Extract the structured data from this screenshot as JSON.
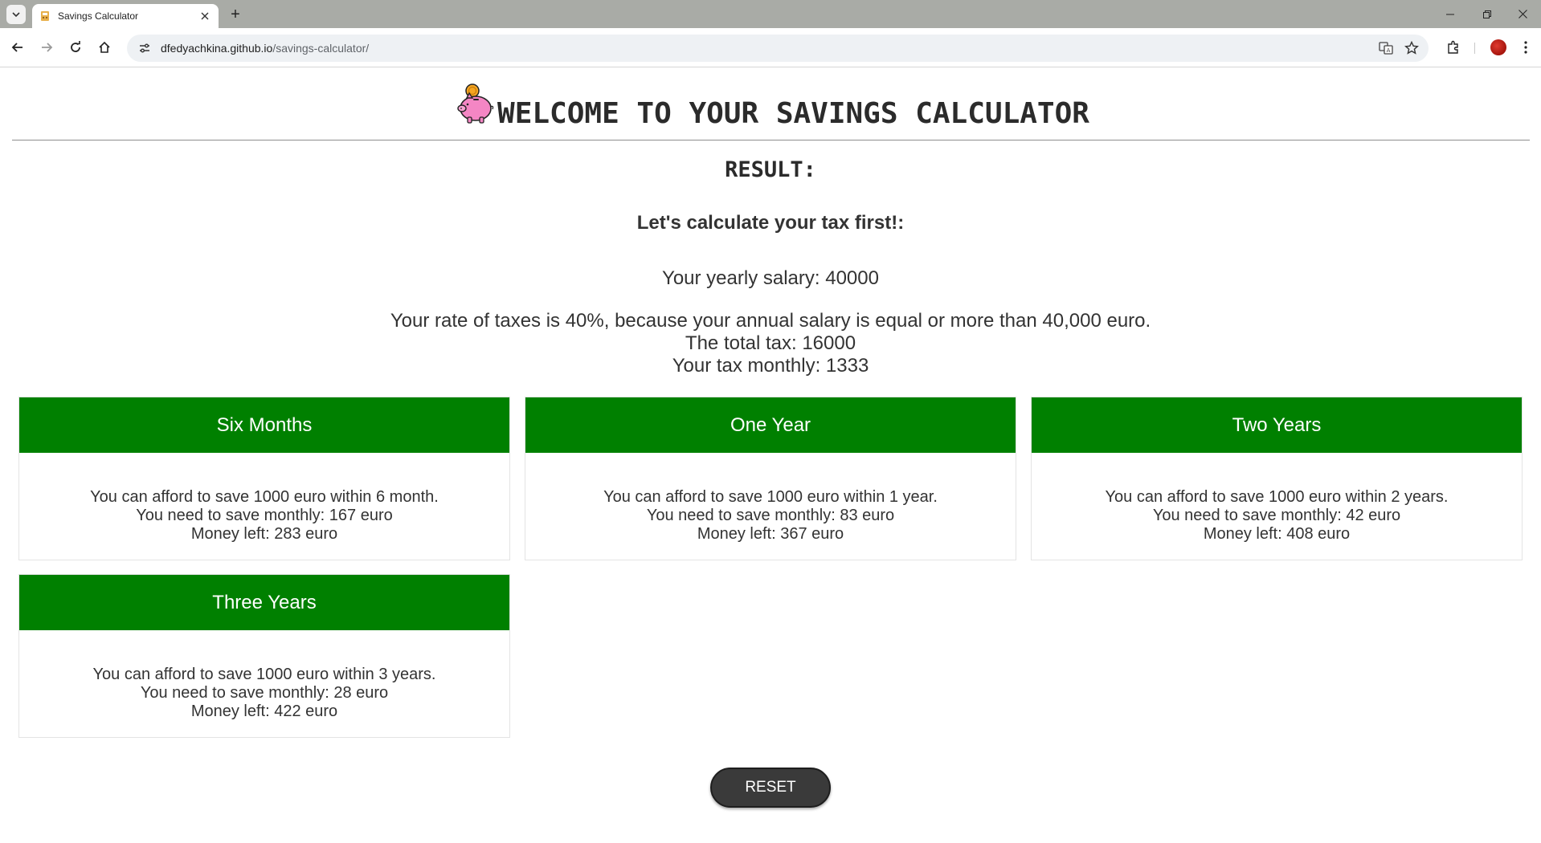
{
  "browser": {
    "tab_title": "Savings Calculator",
    "new_tab_label": "+",
    "url_domain": "dfedyachkina.github.io",
    "url_path": "/savings-calculator/"
  },
  "page": {
    "title": "WELCOME TO YOUR SAVINGS CALCULATOR",
    "result_heading": "RESULT:",
    "tax_subheading": "Let's calculate your tax first!:",
    "salary_line": "Your yearly salary: 40000",
    "tax_rate_line": "Your rate of taxes is 40%, because your annual salary is equal or more than 40,000 euro.",
    "total_tax_line": "The total tax: 16000",
    "monthly_tax_line": "Your tax monthly: 1333"
  },
  "cards": [
    {
      "title": "Six Months",
      "afford": "You can afford to save 1000 euro within 6 month.",
      "monthly": "You need to save monthly: 167 euro",
      "left": "Money left: 283 euro"
    },
    {
      "title": "One Year",
      "afford": "You can afford to save 1000 euro within 1 year.",
      "monthly": "You need to save monthly: 83 euro",
      "left": "Money left: 367 euro"
    },
    {
      "title": "Two Years",
      "afford": "You can afford to save 1000 euro within 2 years.",
      "monthly": "You need to save monthly: 42 euro",
      "left": "Money left: 408 euro"
    },
    {
      "title": "Three Years",
      "afford": "You can afford to save 1000 euro within 3 years.",
      "monthly": "You need to save monthly: 28 euro",
      "left": "Money left: 422 euro"
    }
  ],
  "actions": {
    "reset_label": "RESET"
  },
  "colors": {
    "card_header": "#008000",
    "button_bg": "#3a3a3a",
    "text": "#333333"
  },
  "icons": [
    "tab-search-icon",
    "calculator-favicon-icon",
    "close-icon",
    "minimize-icon",
    "restore-icon",
    "back-icon",
    "forward-icon",
    "reload-icon",
    "home-icon",
    "site-info-icon",
    "translate-icon",
    "bookmark-star-icon",
    "extensions-icon",
    "menu-icon",
    "piggy-bank-icon"
  ]
}
